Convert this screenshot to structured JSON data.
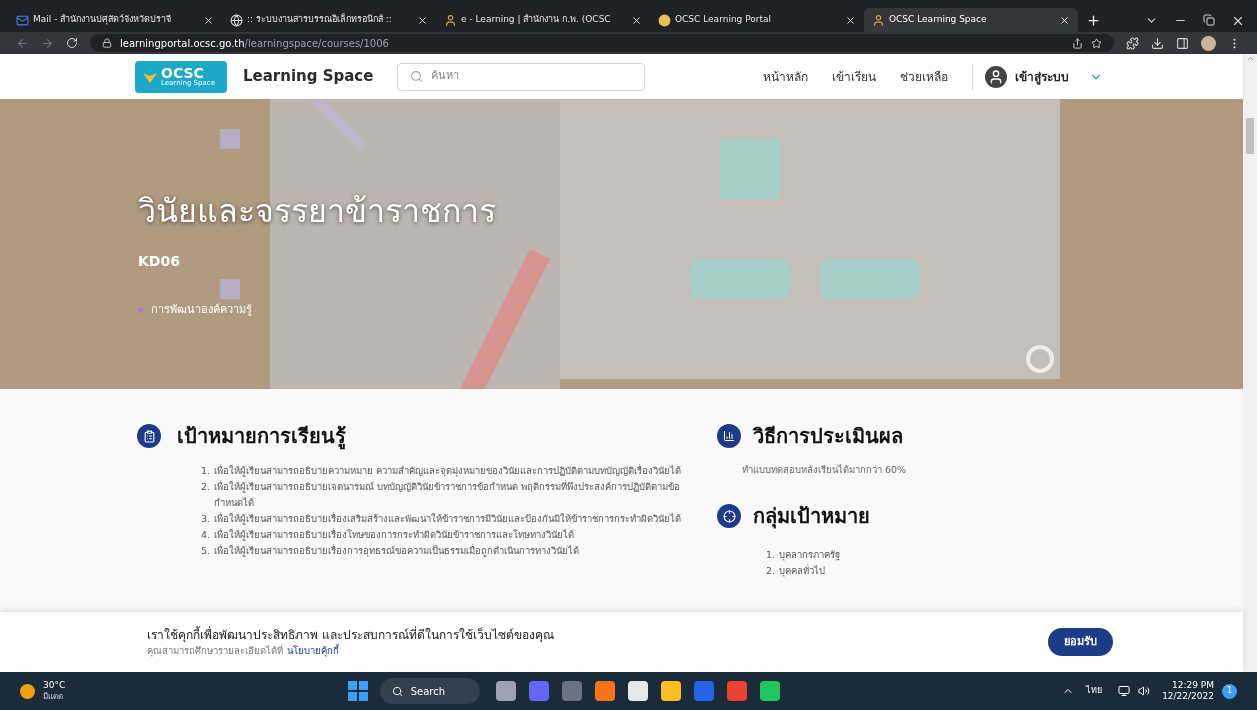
{
  "browser": {
    "tabs": [
      {
        "title": "Mail - สำนักงานปศุสัตว์จังหวัดปราจี",
        "kind": "mail",
        "selected": false
      },
      {
        "title": ":: ระบบงานสารบรรณอิเล็กทรอนิกส์ ::",
        "kind": "globe",
        "selected": false
      },
      {
        "title": "e - Learning | สำนักงาน ก.พ. (OCSC",
        "kind": "person",
        "selected": false
      },
      {
        "title": "OCSC Learning Portal",
        "kind": "coin",
        "selected": false
      },
      {
        "title": "OCSC Learning Space",
        "kind": "person",
        "selected": true
      }
    ],
    "url_host": "learningportal.ocsc.go.th",
    "url_path": "/learningspace/courses/1006"
  },
  "nav": {
    "logo_text": "OCSC",
    "logo_sub": "Learning Space",
    "site_title": "Learning Space",
    "search_placeholder": "ค้นหา",
    "links": [
      "หน้าหลัก",
      "เข้าเรียน",
      "ช่วยเหลือ"
    ],
    "login": "เข้าสู่ระบบ"
  },
  "objective_numbers": [
    "1.",
    "2.",
    "3.",
    "4.",
    "5."
  ],
  "audience_numbers": [
    "1.",
    "2."
  ],
  "hero": {
    "title": "วินัยและจรรยาข้าราชการ",
    "code": "KD06",
    "category": "การพัฒนาองค์ความรู้"
  },
  "objectives": {
    "title": "เป้าหมายการเรียนรู้",
    "items": [
      "เพื่อให้ผู้เรียนสามารถอธิบายความหมาย ความสำคัญและจุดมุ่งหมายของวินัยและการปฏิบัติตามบทบัญญัติเรื่องวินัยได้",
      "เพื่อให้ผู้เรียนสามารถอธิบายเจตนารมณ์ บทบัญญัติวินัยข้าราชการข้อกำหนด พฤติกรรมที่พึงประสงค์การปฏิบัติตามข้อกำหนดได้",
      "เพื่อให้ผู้เรียนสามารถอธิบายเรื่องเสริมสร้างและพัฒนาให้ข้าราชการมีวินัยและป้องกันมิให้ข้าราชการกระทำผิดวินัยได้",
      "เพื่อให้ผู้เรียนสามารถอธิบายเรื่องโทษของการกระทำผิดวินัยข้าราชการและโทษทางวินัยได้",
      "เพื่อให้ผู้เรียนสามารถอธิบายเรื่องการอุทธรณ์ขอความเป็นธรรมเมื่อถูกดำเนินการทางวินัยได้"
    ]
  },
  "evaluation": {
    "title": "วิธีการประเมินผล",
    "text": "ทำแบบทดสอบหลังเรียนได้มากกว่า 60%"
  },
  "audience": {
    "title": "กลุ่มเป้าหมาย",
    "items": [
      "บุคลากรภาครัฐ",
      "บุคคลทั่วไป"
    ]
  },
  "cookie": {
    "title": "เราใช้คุกกี้เพื่อพัฒนาประสิทธิภาพ และประสบการณ์ที่ดีในการใช้เว็บไซต์ของคุณ",
    "text": "คุณสามารถศึกษารายละเอียดได้ที่",
    "link": "นโยบายคุ้กกี้",
    "button": "ยอมรับ"
  },
  "taskbar": {
    "temp": "30°C",
    "weather": "มีแดด",
    "search": "Search",
    "lang": "ไทย",
    "time": "12:29 PM",
    "date": "12/22/2022",
    "badge": "1"
  }
}
